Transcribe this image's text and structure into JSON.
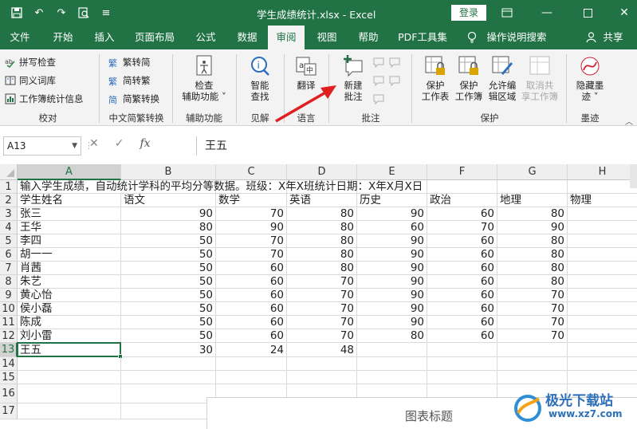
{
  "titlebar": {
    "title": "学生成绩统计.xlsx  -  Excel",
    "login": "登录",
    "accent": "#217346"
  },
  "tabs": [
    "文件",
    "开始",
    "插入",
    "页面布局",
    "公式",
    "数据",
    "审阅",
    "视图",
    "帮助",
    "PDF工具集",
    "操作说明搜索",
    "共享"
  ],
  "active_tab": "审阅",
  "ribbon": {
    "proofing": {
      "items": [
        "拼写检查",
        "同义词库",
        "工作簿统计信息"
      ],
      "label": "校对"
    },
    "chinese": {
      "items": [
        "繁转简",
        "简转繁",
        "简繁转换"
      ],
      "label": "中文简繁转换"
    },
    "accessibility": {
      "button": [
        "检查",
        "辅助功能"
      ],
      "label": "辅助功能"
    },
    "insights": {
      "button": [
        "智能",
        "查找"
      ],
      "label": "见解"
    },
    "language": {
      "button": "翻译",
      "label": "语言"
    },
    "comments": {
      "button": [
        "新建",
        "批注"
      ],
      "label": "批注"
    },
    "protect": {
      "buttons": [
        [
          "保护",
          "工作表"
        ],
        [
          "保护",
          "工作簿"
        ],
        [
          "允许编",
          "辑区域"
        ],
        [
          "取消共",
          "享工作簿"
        ]
      ],
      "label": "保护"
    },
    "ink": {
      "button": [
        "隐藏墨",
        "迹"
      ],
      "label": "墨迹"
    }
  },
  "formula_bar": {
    "name_box": "A13",
    "fx": "fx",
    "value": "王五"
  },
  "columns": [
    "A",
    "B",
    "C",
    "D",
    "E",
    "F",
    "G",
    "H"
  ],
  "selected_column": "A",
  "rows": [
    {
      "n": "1",
      "cells": [
        "输入学生成绩，自动统计学科的平均分等数据。班级：X年X班统计日期：X年X月X日",
        "",
        "",
        "",
        "",
        "",
        "",
        ""
      ]
    },
    {
      "n": "2",
      "cells": [
        "学生姓名",
        "语文",
        "数学",
        "英语",
        "历史",
        "政治",
        "地理",
        "物理"
      ]
    },
    {
      "n": "3",
      "cells": [
        "张三",
        "90",
        "70",
        "80",
        "90",
        "60",
        "80",
        ""
      ]
    },
    {
      "n": "4",
      "cells": [
        "王华",
        "80",
        "90",
        "80",
        "60",
        "70",
        "90",
        ""
      ]
    },
    {
      "n": "5",
      "cells": [
        "李四",
        "50",
        "70",
        "80",
        "90",
        "60",
        "80",
        ""
      ]
    },
    {
      "n": "6",
      "cells": [
        "胡一一",
        "50",
        "70",
        "80",
        "90",
        "60",
        "80",
        ""
      ]
    },
    {
      "n": "7",
      "cells": [
        "肖茜",
        "50",
        "60",
        "80",
        "90",
        "60",
        "80",
        ""
      ]
    },
    {
      "n": "8",
      "cells": [
        "朱艺",
        "50",
        "60",
        "70",
        "90",
        "60",
        "80",
        ""
      ]
    },
    {
      "n": "9",
      "cells": [
        "黄心怡",
        "50",
        "60",
        "70",
        "90",
        "60",
        "70",
        ""
      ]
    },
    {
      "n": "10",
      "cells": [
        "侯小磊",
        "50",
        "60",
        "70",
        "90",
        "60",
        "70",
        ""
      ]
    },
    {
      "n": "11",
      "cells": [
        "陈成",
        "50",
        "60",
        "70",
        "90",
        "60",
        "70",
        ""
      ]
    },
    {
      "n": "12",
      "cells": [
        "刘小雷",
        "50",
        "60",
        "70",
        "80",
        "60",
        "70",
        ""
      ]
    },
    {
      "n": "13",
      "cells": [
        "王五",
        "30",
        "24",
        "48",
        "",
        "",
        "",
        ""
      ]
    },
    {
      "n": "14",
      "cells": [
        "",
        "",
        "",
        "",
        "",
        "",
        "",
        ""
      ]
    },
    {
      "n": "15",
      "cells": [
        "",
        "",
        "",
        "",
        "",
        "",
        "",
        ""
      ]
    },
    {
      "n": "16",
      "cells": [
        "",
        "",
        "",
        "",
        "",
        "",
        "",
        ""
      ]
    },
    {
      "n": "17",
      "cells": [
        "",
        "",
        "",
        "",
        "",
        "",
        "",
        ""
      ]
    }
  ],
  "selected_row": "13",
  "chart_title": "图表标题",
  "watermark": {
    "line1": "极光下载站",
    "line2": "www.xz7.com"
  }
}
